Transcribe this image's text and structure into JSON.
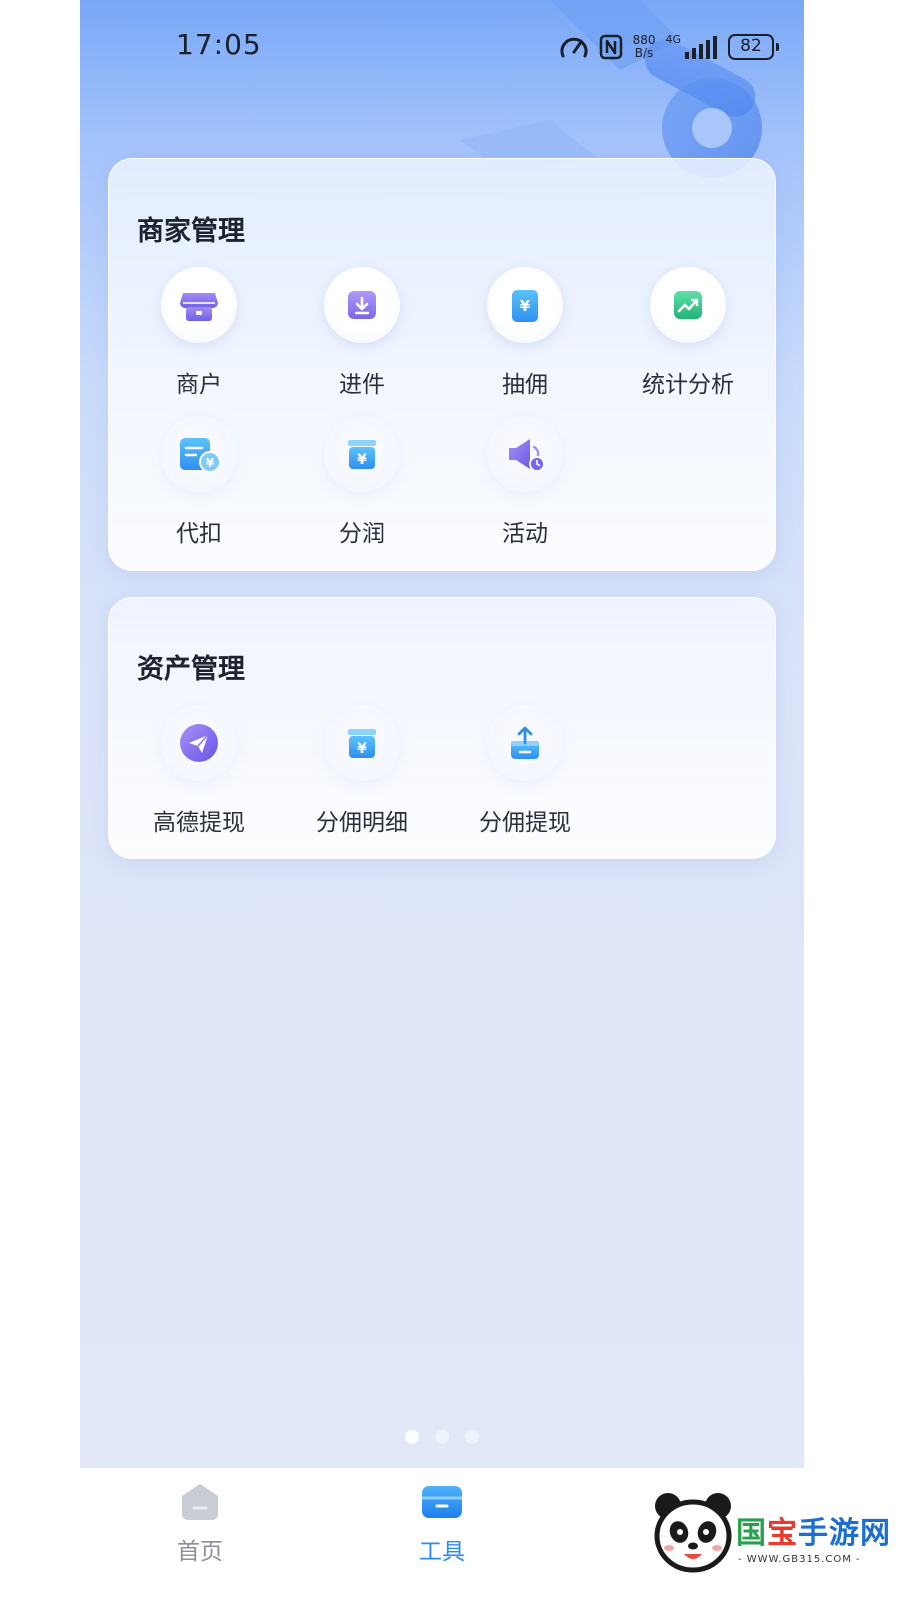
{
  "status_bar": {
    "time": "17:05",
    "net_speed_value": "880",
    "net_speed_unit": "B/s",
    "network": "4G",
    "battery": "82",
    "icons": [
      "speedometer-icon",
      "nfc-icon",
      "signal-icon",
      "battery-icon"
    ]
  },
  "merchant_section": {
    "title": "商家管理",
    "items": [
      {
        "label": "商户",
        "icon": "store-icon"
      },
      {
        "label": "进件",
        "icon": "download-box-icon"
      },
      {
        "label": "抽佣",
        "icon": "yuan-note-icon"
      },
      {
        "label": "统计分析",
        "icon": "trend-chart-icon"
      },
      {
        "label": "代扣",
        "icon": "bill-yuan-icon"
      },
      {
        "label": "分润",
        "icon": "yuan-box-icon"
      },
      {
        "label": "活动",
        "icon": "megaphone-icon"
      }
    ]
  },
  "assets_section": {
    "title": "资产管理",
    "items": [
      {
        "label": "高德提现",
        "icon": "paper-plane-icon"
      },
      {
        "label": "分佣明细",
        "icon": "yuan-box-icon"
      },
      {
        "label": "分佣提现",
        "icon": "upload-box-icon"
      }
    ]
  },
  "pager": {
    "total": 3,
    "active": 1
  },
  "tabbar": {
    "tabs": [
      {
        "label": "首页",
        "icon": "home-icon",
        "active": false
      },
      {
        "label": "工具",
        "icon": "toolbox-icon",
        "active": true
      }
    ],
    "active_color": "#2b8cf2",
    "inactive_color": "#8a8f99"
  },
  "watermark": {
    "brand_1": "国",
    "brand_2": "宝",
    "brand_3": "手游网",
    "url": "- WWW.GB315.COM -"
  }
}
